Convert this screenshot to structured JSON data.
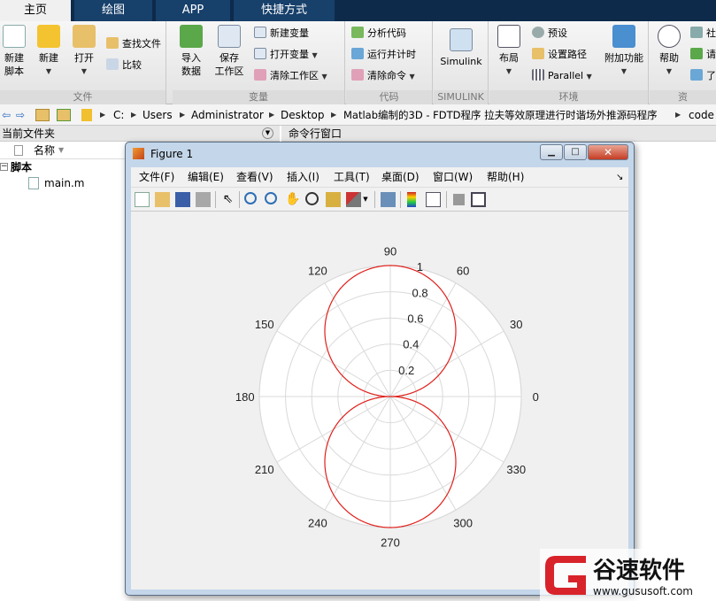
{
  "tabs": [
    {
      "label": "主页",
      "active": true
    },
    {
      "label": "绘图",
      "active": false
    },
    {
      "label": "APP",
      "active": false
    },
    {
      "label": "快捷方式",
      "active": false
    }
  ],
  "ribbon": {
    "file_group": {
      "title": "文件",
      "new_script": "新建\n脚本",
      "new": "新建",
      "open": "打开",
      "find_files": "查找文件",
      "compare": "比较"
    },
    "variable_group": {
      "title": "变量",
      "import_data": "导入\n数据",
      "save_workspace": "保存\n工作区",
      "new_variable": "新建变量",
      "open_variable": "打开变量",
      "clear_workspace": "清除工作区"
    },
    "code_group": {
      "title": "代码",
      "analyze_code": "分析代码",
      "run_and_time": "运行并计时",
      "clear_commands": "清除命令"
    },
    "simulink_group": {
      "title": "SIMULINK",
      "simulink": "Simulink"
    },
    "environment_group": {
      "title": "环境",
      "layout": "布局",
      "preferences": "预设",
      "set_path": "设置路径",
      "parallel": "Parallel",
      "addons": "附加功能"
    },
    "resources_group": {
      "title": "资",
      "help": "帮助",
      "community_1": "社",
      "community_2": "请",
      "community_3": "了"
    }
  },
  "address": {
    "parts": [
      "C:",
      "Users",
      "Administrator",
      "Desktop",
      "Matlab编制的3D - FDTD程序 拉夫等效原理进行时谐场外推源码程序",
      "code"
    ]
  },
  "left_panel": {
    "title": "当前文件夹",
    "column_name": "名称",
    "folder": "脚本",
    "file": "main.m"
  },
  "command_window": {
    "title": "命令行窗口"
  },
  "figure": {
    "title": "Figure 1",
    "menu": [
      "文件(F)",
      "编辑(E)",
      "查看(V)",
      "插入(I)",
      "工具(T)",
      "桌面(D)",
      "窗口(W)",
      "帮助(H)"
    ],
    "toolbar_icons": [
      "new-figure-icon",
      "open-file-icon",
      "save-icon",
      "print-icon",
      "select-arrow-icon",
      "zoom-in-icon",
      "zoom-out-icon",
      "pan-hand-icon",
      "rotate-3d-icon",
      "data-cursor-icon",
      "brush-icon",
      "link-plot-icon",
      "colorbar-icon",
      "legend-icon",
      "hide-plot-tools-icon",
      "show-plot-tools-icon"
    ]
  },
  "chart_data": {
    "type": "line",
    "coordinate_system": "polar",
    "theta_ticks_deg": [
      0,
      30,
      60,
      90,
      120,
      150,
      180,
      210,
      240,
      270,
      300,
      330
    ],
    "theta_tick_labels": [
      "0",
      "30",
      "60",
      "90",
      "120",
      "150",
      "180",
      "210",
      "240",
      "270",
      "300",
      "330"
    ],
    "r_ticks": [
      0.2,
      0.4,
      0.6,
      0.8,
      1
    ],
    "r_tick_labels": [
      "0.2",
      "0.4",
      "0.6",
      "0.8",
      "1"
    ],
    "rlim": [
      0,
      1
    ],
    "r_label_angle_deg": 80,
    "grid": true,
    "series": [
      {
        "color": "#e0201b",
        "function": "|sin(theta)|",
        "theta_deg": [
          0,
          15,
          30,
          45,
          60,
          75,
          90,
          105,
          120,
          135,
          150,
          165,
          180,
          195,
          210,
          225,
          240,
          255,
          270,
          285,
          300,
          315,
          330,
          345,
          360
        ],
        "r": [
          0,
          0.259,
          0.5,
          0.707,
          0.866,
          0.966,
          1,
          0.966,
          0.866,
          0.707,
          0.5,
          0.259,
          0,
          0.259,
          0.5,
          0.707,
          0.866,
          0.966,
          1,
          0.966,
          0.866,
          0.707,
          0.5,
          0.259,
          0
        ]
      }
    ]
  },
  "watermark": {
    "brand": "谷速软件",
    "url": "www.gususoft.com"
  },
  "colors": {
    "tab_bar": "#0d2a4a",
    "plot_line": "#e0201b",
    "grid": "#d9d9d9"
  }
}
